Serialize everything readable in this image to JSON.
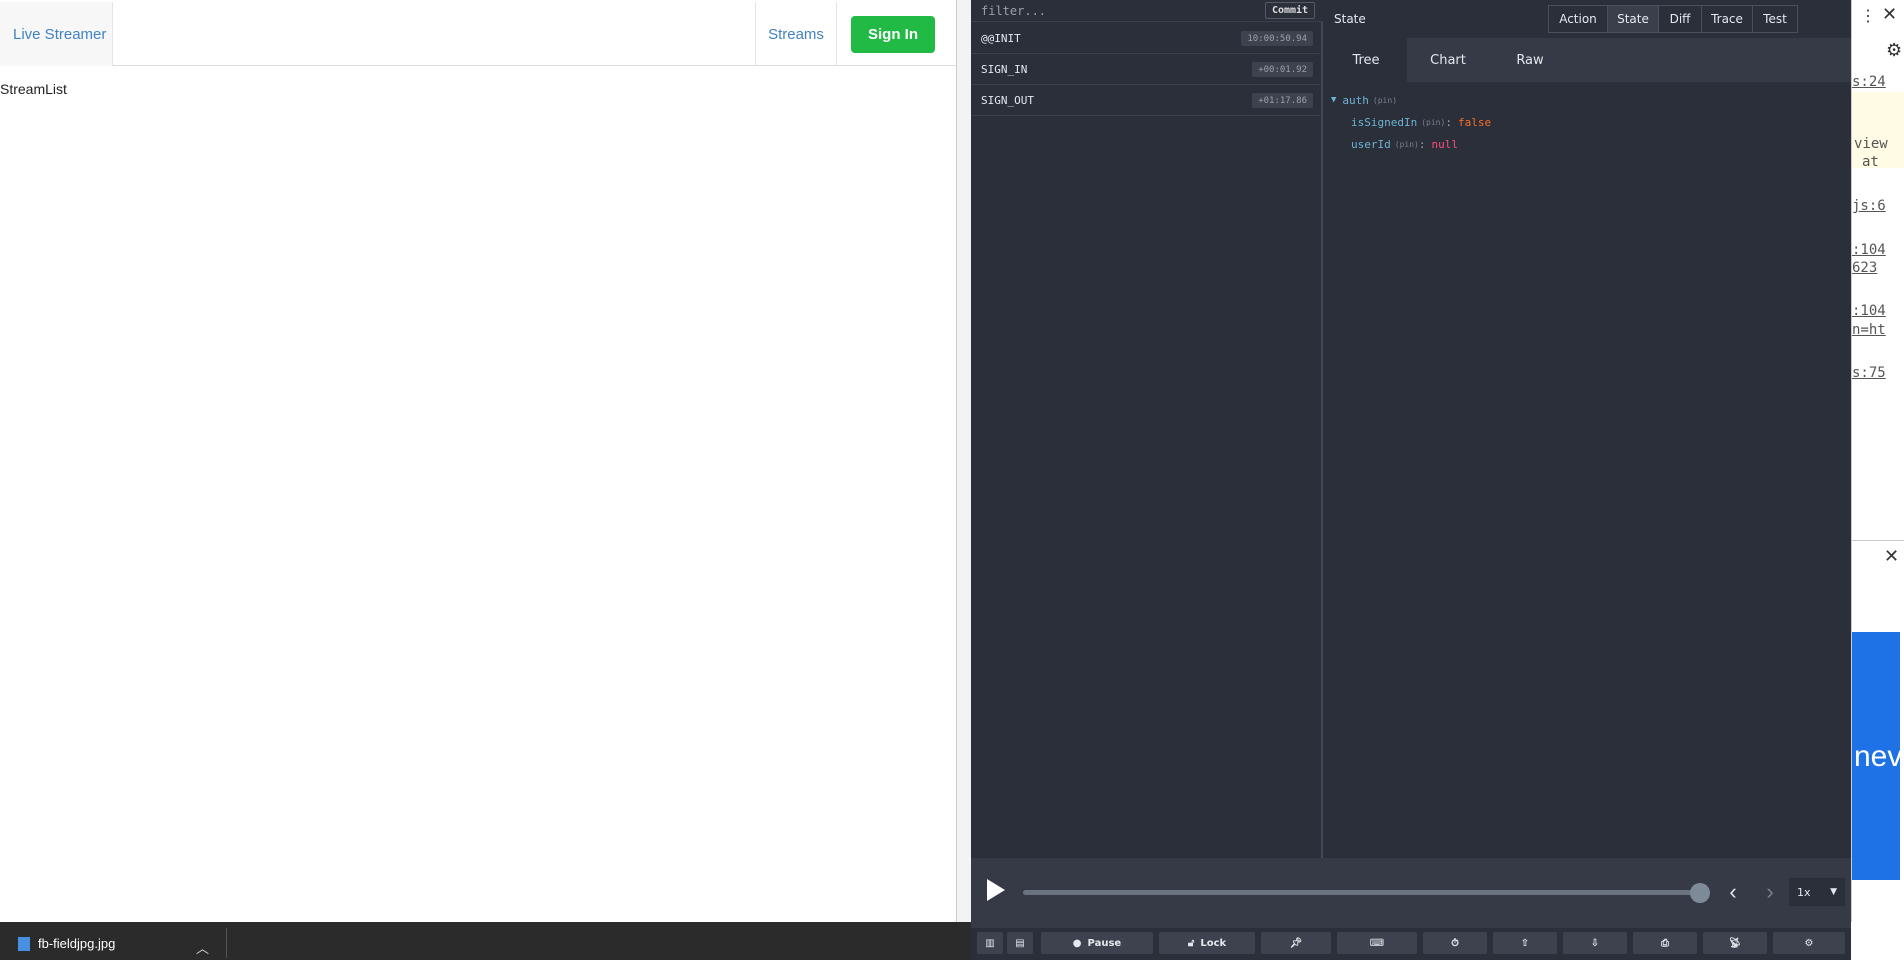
{
  "app": {
    "brand": "Live Streamer",
    "nav_streams": "Streams",
    "signin": "Sign In",
    "content_text": "StreamList"
  },
  "redux": {
    "filter_placeholder": "filter...",
    "commit_label": "Commit",
    "actions": [
      {
        "name": "@@INIT",
        "time": "10:00:50.94"
      },
      {
        "name": "SIGN_IN",
        "time": "+00:01.92"
      },
      {
        "name": "SIGN_OUT",
        "time": "+01:17.86"
      }
    ],
    "state_title": "State",
    "top_tabs": [
      "Action",
      "State",
      "Diff",
      "Trace",
      "Test"
    ],
    "sub_tabs": [
      "Tree",
      "Chart",
      "Raw"
    ],
    "tree": {
      "root_key": "auth",
      "pin": "(pin)",
      "children": [
        {
          "key": "isSignedIn",
          "value": "false"
        },
        {
          "key": "userId",
          "value": "null"
        }
      ]
    },
    "speed": "1x",
    "bottom_buttons": [
      "",
      "",
      "Pause",
      "Lock",
      "",
      "",
      "",
      "",
      "",
      "",
      "",
      ""
    ]
  },
  "console": {
    "links": [
      "s:24",
      "view",
      "at",
      "js:6",
      ":104",
      "623",
      ":104",
      "n=ht",
      "s:75"
    ],
    "image_text": "nev"
  },
  "taskbar": {
    "file_name": "fb-fieldjpg.jpg"
  },
  "colors": {
    "accent_green": "#21ba45",
    "link_blue": "#4183c4",
    "devtools_bg": "#2a2f3a"
  }
}
